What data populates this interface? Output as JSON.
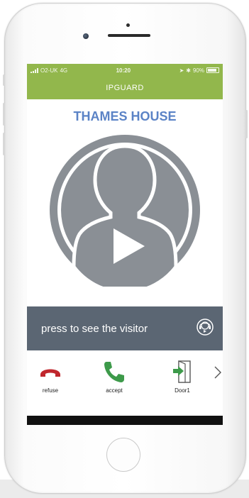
{
  "status_bar": {
    "carrier": "O2-UK",
    "network": "4G",
    "time": "10:20",
    "battery": "90%"
  },
  "app": {
    "title": "IPGUARD"
  },
  "site": {
    "name": "THAMES HOUSE"
  },
  "visitor": {
    "prompt": "press to see the visitor"
  },
  "actions": [
    {
      "label": "refuse",
      "icon": "hang-up-icon",
      "color": "#c0272d"
    },
    {
      "label": "accept",
      "icon": "phone-icon",
      "color": "#3d9a4a"
    },
    {
      "label": "Door1",
      "icon": "door-open-icon",
      "color": "#3d9a4a"
    }
  ],
  "colors": {
    "header_green": "#92b74c",
    "title_blue": "#5b83c6",
    "visitor_bar": "#5b6673",
    "avatar_grey": "#8a8f95"
  }
}
